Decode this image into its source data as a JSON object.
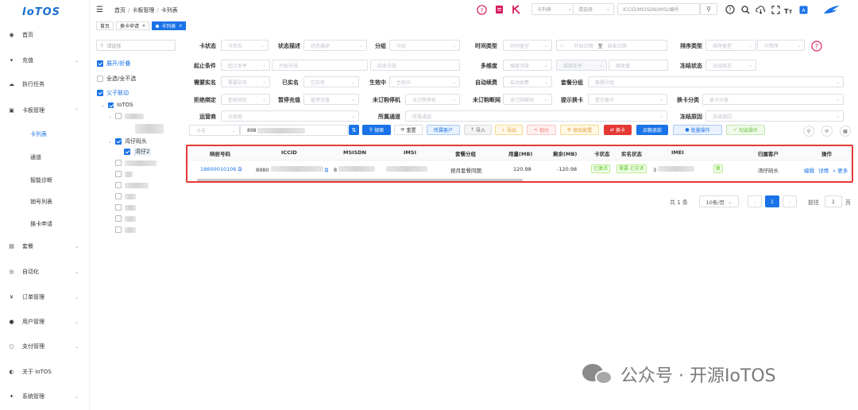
{
  "app": {
    "logo": "IoTOS"
  },
  "sidebar": {
    "items": [
      {
        "label": "首页",
        "icon": "dashboard-icon",
        "chev": false
      },
      {
        "label": "充值",
        "icon": "cart-icon",
        "chev": true
      },
      {
        "label": "执行任务",
        "icon": "cloud-icon",
        "chev": false
      },
      {
        "label": "卡板管理",
        "icon": "card-icon",
        "chev": true
      },
      {
        "label": "套餐",
        "icon": "package-icon",
        "chev": true
      },
      {
        "label": "自动化",
        "icon": "automation-icon",
        "chev": true
      },
      {
        "label": "订单管理",
        "icon": "yen-icon",
        "chev": true
      },
      {
        "label": "用户管理",
        "icon": "user-icon",
        "chev": true
      },
      {
        "label": "支付管理",
        "icon": "payment-icon",
        "chev": true
      },
      {
        "label": "关于 IoTOS",
        "icon": "globe-icon",
        "chev": false
      },
      {
        "label": "系统管理",
        "icon": "gear-icon",
        "chev": true
      }
    ],
    "sub_items": [
      "卡列表",
      "通道",
      "智能诊断",
      "销号列表",
      "换卡申请"
    ]
  },
  "header": {
    "breadcrumb": [
      "首页",
      "卡板管理",
      "卡列表"
    ],
    "search_type": "卡列表",
    "search_select_placeholder": "请选择",
    "search_placeholder": "ICCID/MSISDN/IMSI/编号"
  },
  "tabs": [
    {
      "label": "首页",
      "active": false,
      "closable": false
    },
    {
      "label": "换卡申请",
      "active": false,
      "closable": true
    },
    {
      "label": "卡列表",
      "active": true,
      "closable": true
    }
  ],
  "tree": {
    "search_placeholder": "请选择",
    "options": [
      {
        "label": "展开/折叠",
        "checked": true,
        "blue": true
      },
      {
        "label": "全选/全不选",
        "checked": false,
        "blue": false
      },
      {
        "label": "父子联动",
        "checked": true,
        "blue": true
      }
    ],
    "root": "IoTOS",
    "agent": "湾仔码头",
    "child": "湾仔2"
  },
  "filters": {
    "row1": [
      {
        "label": "卡状态",
        "placeholder": "卡状态"
      },
      {
        "label": "状态描述",
        "placeholder": "状态描述"
      },
      {
        "label": "分组",
        "placeholder": "分组"
      },
      {
        "label": "时间类型",
        "placeholder": "时间类型"
      },
      {
        "label": "",
        "placeholder": "开始日期",
        "to": "至",
        "end": "结束日期"
      },
      {
        "label": "排序类型",
        "placeholder": "排序类型",
        "order": "升降序"
      }
    ],
    "row2": [
      {
        "label": "起止条件",
        "placeholder": "起止条件",
        "start": "开始号段",
        "end": "结束号段"
      },
      {
        "label": "多维度",
        "placeholder": "维度字段",
        "cond": "维度条件",
        "val": "维度值"
      },
      {
        "label": "冻结状态",
        "placeholder": "冻结状态"
      }
    ],
    "row3": [
      {
        "label": "需要实名",
        "placeholder": "需要实名"
      },
      {
        "label": "已实名",
        "placeholder": "已实名"
      },
      {
        "label": "生效中",
        "placeholder": "生效中"
      },
      {
        "label": "自动续费",
        "placeholder": "自动续费"
      },
      {
        "label": "套餐分组",
        "placeholder": "套餐分组"
      }
    ],
    "row4": [
      {
        "label": "拒绝绑定",
        "placeholder": "拒绝绑定"
      },
      {
        "label": "暂停充值",
        "placeholder": "暂停充值"
      },
      {
        "label": "未订购停机",
        "placeholder": "未订购停机"
      },
      {
        "label": "未订购断网",
        "placeholder": "未订购断网"
      },
      {
        "label": "提示换卡",
        "placeholder": "提示换卡"
      },
      {
        "label": "换卡分类",
        "placeholder": "换卡分类"
      }
    ],
    "row5": [
      {
        "label": "运营商",
        "placeholder": "运营商"
      },
      {
        "label": "所属通道",
        "placeholder": "所属通道"
      },
      {
        "label": "冻结原因",
        "placeholder": "冻结原因"
      }
    ],
    "card_type": "卡号",
    "card_value": "898"
  },
  "actions": [
    {
      "label": "搜索",
      "style": "primary"
    },
    {
      "label": "重置",
      "style": "default"
    },
    {
      "label": "所属客户",
      "style": "info"
    },
    {
      "label": "导入",
      "style": "plain"
    },
    {
      "label": "导出",
      "style": "warning"
    },
    {
      "label": "划分",
      "style": "danger-light"
    },
    {
      "label": "修改配置",
      "style": "warning"
    },
    {
      "label": "换卡",
      "style": "danger"
    },
    {
      "label": "余额退款",
      "style": "primary"
    },
    {
      "label": "批量操作",
      "style": "info"
    },
    {
      "label": "勾选操作",
      "style": "success"
    }
  ],
  "table": {
    "columns": [
      "映射号码",
      "ICCID",
      "MSISDN",
      "IMSI",
      "套餐分组",
      "用量(MB)",
      "剩余(MB)",
      "卡状态",
      "实名状态",
      "IMEI",
      "归属客户",
      "操作"
    ],
    "rows": [
      {
        "mapped_number": "18600010106",
        "iccid": "8980",
        "msisdn": "8",
        "imsi": "",
        "package_group": "按月套餐同期",
        "used": "120.98",
        "remaining": "-120.98",
        "card_status": "已激活",
        "realname_status": "需要-已实名",
        "imei": "3",
        "extra": "联",
        "customer": "湾仔码头",
        "ops": [
          "编辑",
          "详情",
          "更多"
        ]
      }
    ]
  },
  "pagination": {
    "total": "共 1 条",
    "page_size": "10条/页",
    "current_page": "1",
    "goto_label": "前往",
    "goto_value": "1",
    "page_suffix": "页"
  },
  "watermark": {
    "text": "公众号 · 开源IoTOS"
  },
  "colors": {
    "primary": "#1a73e8",
    "danger": "#e53935",
    "success": "#52c41a",
    "warning": "#fa8c16",
    "magenta": "#d81b60"
  }
}
